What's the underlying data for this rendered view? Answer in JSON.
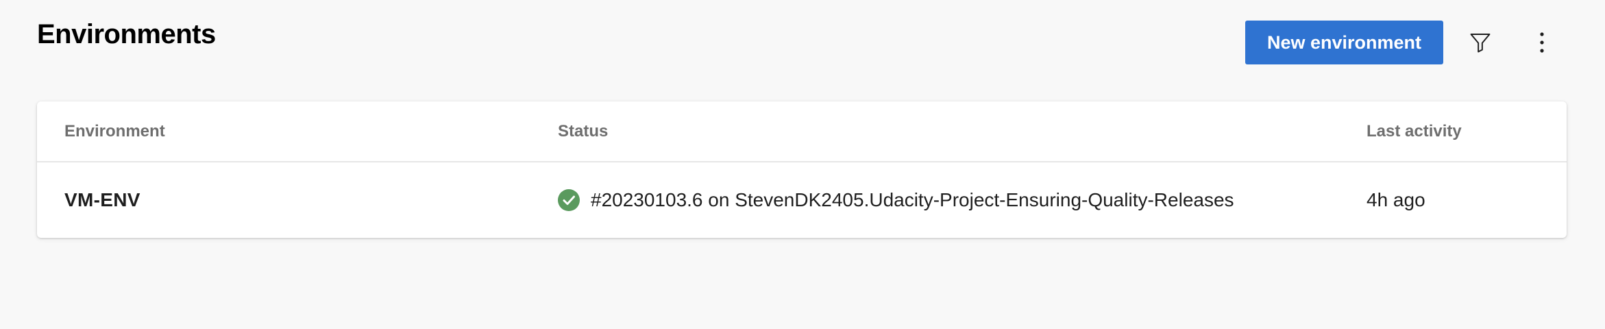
{
  "page": {
    "title": "Environments"
  },
  "toolbar": {
    "new_environment_label": "New environment",
    "filter_icon": "filter-icon",
    "more_icon": "more-options-icon"
  },
  "table": {
    "columns": [
      "Environment",
      "Status",
      "Last activity"
    ],
    "rows": [
      {
        "environment": "VM-ENV",
        "status_icon": "success-check-icon",
        "status_text": "#20230103.6 on StevenDK2405.Udacity-Project-Ensuring-Quality-Releases",
        "last_activity": "4h ago"
      }
    ]
  },
  "colors": {
    "primary": "#2f73d1",
    "success": "#5a9a5e",
    "background": "#f8f8f8"
  }
}
